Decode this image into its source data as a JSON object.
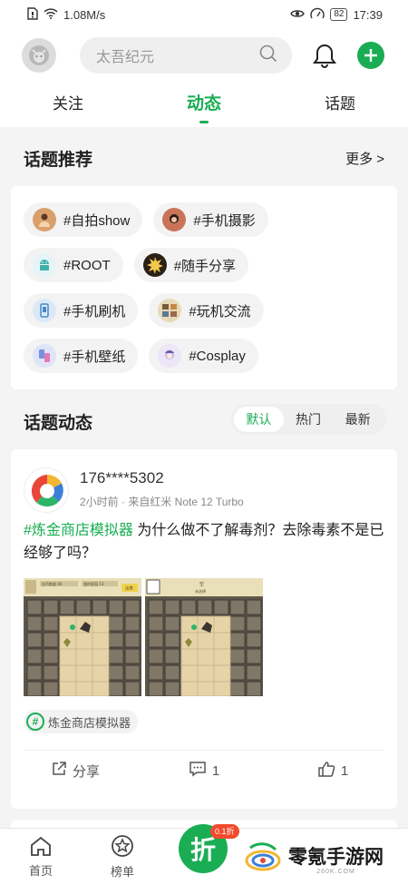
{
  "status_bar": {
    "speed": "1.08M/s",
    "battery": "82",
    "time": "17:39"
  },
  "header": {
    "search_placeholder": "太吾纪元",
    "avatar_icon": "user-avatar-icon",
    "bell_icon": "bell-icon",
    "add_icon": "plus-icon"
  },
  "tabs": [
    {
      "label": "关注",
      "active": false
    },
    {
      "label": "动态",
      "active": true
    },
    {
      "label": "话题",
      "active": false
    }
  ],
  "topics_section": {
    "title": "话题推荐",
    "more": "更多 >",
    "chips": [
      {
        "label": "#自拍show"
      },
      {
        "label": "#手机摄影"
      },
      {
        "label": "#ROOT"
      },
      {
        "label": "#随手分享"
      },
      {
        "label": "#手机刷机"
      },
      {
        "label": "#玩机交流"
      },
      {
        "label": "#手机壁纸"
      },
      {
        "label": "#Cosplay"
      }
    ]
  },
  "feed_section": {
    "title": "话题动态",
    "filters": [
      {
        "label": "默认",
        "active": true
      },
      {
        "label": "热门",
        "active": false
      },
      {
        "label": "最新",
        "active": false
      }
    ]
  },
  "post": {
    "username": "176****5302",
    "meta": "2小时前 · 来自红米 Note 12 Turbo",
    "hashtag": "#炼金商店模拟器",
    "text": " 为什么做不了解毒剂？去除毒素不是已经够了吗？",
    "game_labels": {
      "img1_left": "金币数量 48",
      "img1_right": "我的家园 13",
      "img1_btn": "出售",
      "img2_top": "空",
      "img2_sub": "未选择"
    },
    "topic_tag": "炼金商店模拟器",
    "actions": {
      "share": "分享",
      "comments": "1",
      "likes": "1"
    }
  },
  "bottom_nav": {
    "home": "首页",
    "ranking": "榜单",
    "center_label": "折",
    "badge": "0.1折"
  },
  "watermark": {
    "text": "零氪手游网",
    "url": "260K.COM"
  },
  "colors": {
    "accent": "#1aad53",
    "badge": "#f24a2c"
  }
}
